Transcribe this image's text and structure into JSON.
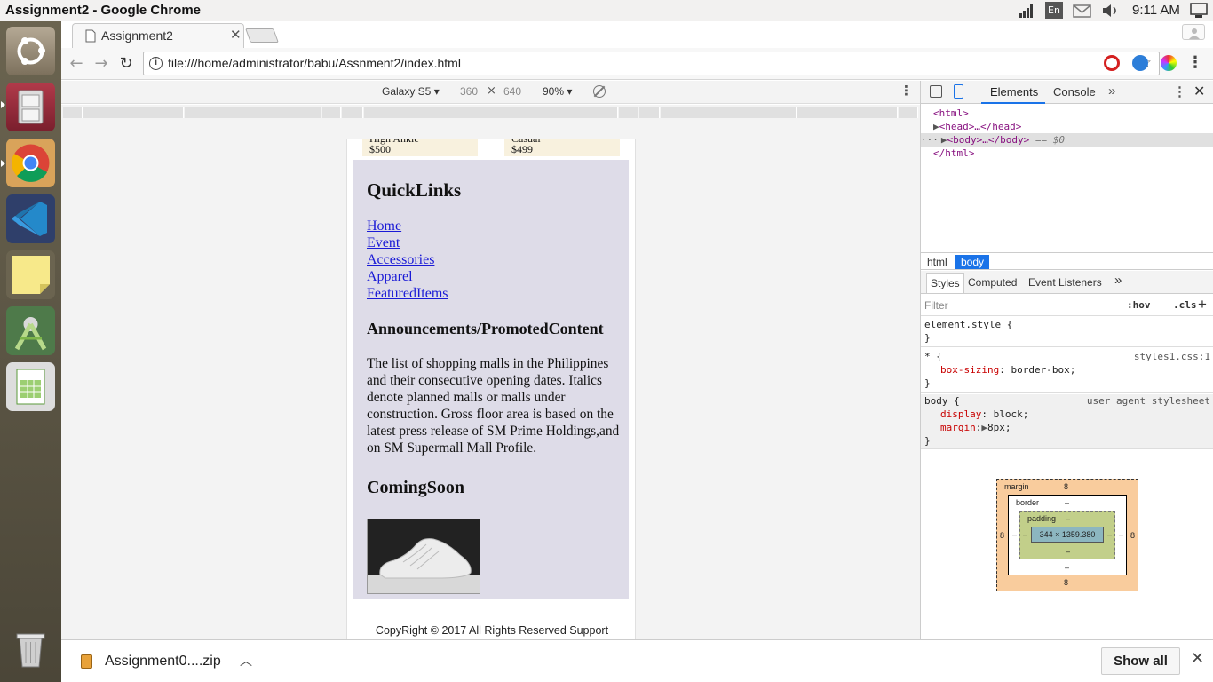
{
  "panel": {
    "window_title": "Assignment2 - Google Chrome",
    "lang": "En",
    "time": "9:11 AM"
  },
  "launcher": {
    "items": [
      "ubuntu-logo",
      "files",
      "chrome",
      "vscode",
      "sticky-notes",
      "android-studio",
      "calc"
    ],
    "trash": "trash"
  },
  "browser": {
    "tab_title": "Assignment2",
    "url": "file:///home/administrator/babu/Assnment2/index.html",
    "device": {
      "name": "Galaxy S5",
      "width": "360",
      "x": "×",
      "height": "640",
      "zoom": "90%"
    }
  },
  "page": {
    "products": [
      {
        "name": "High Ankle",
        "price": "$500"
      },
      {
        "name": "Casual",
        "price": "$499"
      }
    ],
    "quicklinks_title": "QuickLinks",
    "links": [
      "Home",
      "Event",
      "Accessories",
      "Apparel",
      "FeaturedItems"
    ],
    "announce_title": "Announcements/PromotedContent",
    "announce_text": "The list of shopping malls in the Philippines and their consecutive opening dates. Italics denote planned malls or malls under construction. Gross floor area is based on the latest press release of SM Prime Holdings,and on SM Supermall Mall Profile.",
    "coming_title": "ComingSoon",
    "footer": "CopyRight © 2017 All Rights Reserved Support"
  },
  "devtools": {
    "tabs": [
      "Elements",
      "Console"
    ],
    "dom": {
      "html_open": "<html>",
      "head": "<head>…</head>",
      "body": "<body>…</body>",
      "selected_marker": "== $0",
      "html_close": "</html>"
    },
    "crumbs": [
      "html",
      "body"
    ],
    "style_tabs": [
      "Styles",
      "Computed",
      "Event Listeners"
    ],
    "filter_placeholder": "Filter",
    "hov": ":hov",
    "cls": ".cls",
    "rules": {
      "element_style": "element.style {",
      "close": "}",
      "star_selector": "* {",
      "star_source": "styles1.css:1",
      "star_prop": "box-sizing",
      "star_val": "border-box;",
      "body_selector": "body {",
      "body_source": "user agent stylesheet",
      "body_prop1": "display",
      "body_val1": "block;",
      "body_prop2": "margin",
      "body_val2": "8px;"
    },
    "boxmodel": {
      "margin_label": "margin",
      "margin": "8",
      "border_label": "border",
      "dash": "–",
      "padding_label": "padding",
      "content": "344 × 1359.380"
    }
  },
  "downloads": {
    "file": "Assignment0....zip",
    "show_all": "Show all"
  }
}
